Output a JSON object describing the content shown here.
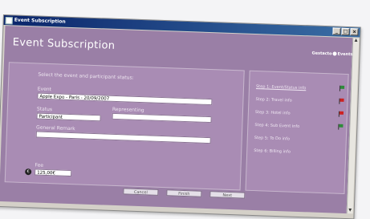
{
  "window": {
    "title": "Event Subscription",
    "controls": [
      "_",
      "□",
      "×"
    ]
  },
  "page": {
    "title": "Event Subscription",
    "logo_text": "Gestacto",
    "logo_suffix": "Events"
  },
  "form": {
    "instruction": "Select the event and participant status:",
    "event_label": "Event",
    "event_value": "Apple Expo - Paris - 20/09/2007",
    "status_label": "Status",
    "status_value": "Participant",
    "representing_label": "Representing",
    "representing_value": "",
    "remark_label": "General Remark",
    "remark_value": "",
    "fee_label": "Fee",
    "fee_value": "125,00€"
  },
  "steps": [
    {
      "label": "Step 1: Event/Status info",
      "active": true,
      "flag_color": "#2e8b3a"
    },
    {
      "label": "Step 2: Travel info",
      "active": false,
      "flag_color": "#cc2222"
    },
    {
      "label": "Step 3: Hotel info",
      "active": false,
      "flag_color": "#cc2222"
    },
    {
      "label": "Step 4: Sub Event info",
      "active": false,
      "flag_color": "#2e8b3a"
    },
    {
      "label": "Step 5: To Do info",
      "active": false,
      "flag_color": null
    },
    {
      "label": "Step 6: Billing info",
      "active": false,
      "flag_color": null
    }
  ],
  "buttons": {
    "cancel": "Cancel",
    "finish": "Finish",
    "next": "Next"
  }
}
